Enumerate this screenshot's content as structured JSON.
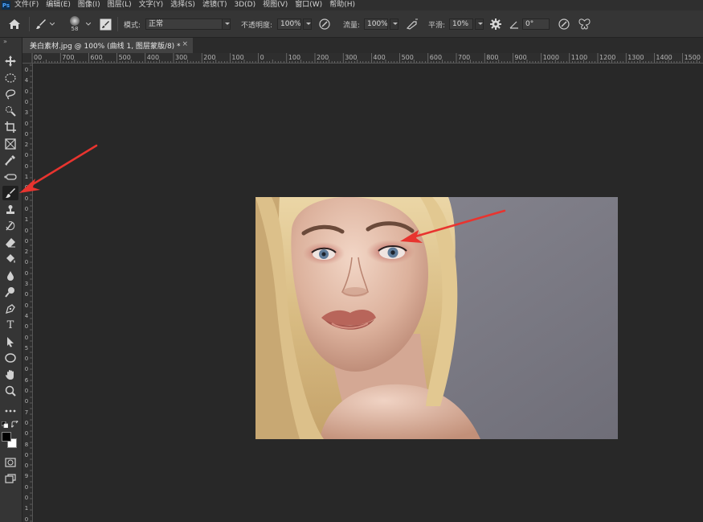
{
  "app": {
    "logo_text": "Ps",
    "accent": "#31a8ff"
  },
  "menu": [
    "文件(F)",
    "编辑(E)",
    "图像(I)",
    "图层(L)",
    "文字(Y)",
    "选择(S)",
    "滤镜(T)",
    "3D(D)",
    "视图(V)",
    "窗口(W)",
    "帮助(H)"
  ],
  "options": {
    "brush_size": "58",
    "mode_label": "模式:",
    "mode_value": "正常",
    "opacity_label": "不透明度:",
    "opacity_value": "100%",
    "flow_label": "流量:",
    "flow_value": "100%",
    "smoothing_label": "平滑:",
    "smoothing_value": "10%",
    "angle_value": "0°"
  },
  "document": {
    "tab_title": "美白素材.jpg @ 100% (曲线 1, 图层蒙版/8) *",
    "close_glyph": "×"
  },
  "ruler_top": [
    "00",
    "700",
    "600",
    "500",
    "400",
    "300",
    "200",
    "100",
    "0",
    "100",
    "200",
    "300",
    "400",
    "500",
    "600",
    "700",
    "800",
    "900",
    "1000",
    "1100",
    "1200",
    "1300",
    "1400",
    "1500"
  ],
  "ruler_left": [
    "0",
    "4",
    "0",
    "0",
    "3",
    "0",
    "0",
    "2",
    "0",
    "0",
    "1",
    "0",
    "0",
    "0",
    "1",
    "0",
    "0",
    "2",
    "0",
    "0",
    "3",
    "0",
    "0",
    "4",
    "0",
    "0",
    "5",
    "0",
    "0",
    "6",
    "0",
    "0",
    "7",
    "0",
    "0",
    "8",
    "0",
    "0",
    "9",
    "0",
    "0",
    "1",
    "0"
  ],
  "toolbar": {
    "collapse_glyph": "»",
    "tools": [
      "move-icon",
      "marquee-icon",
      "lasso-icon",
      "quick-select-icon",
      "crop-icon",
      "frame-icon",
      "eyedropper-icon",
      "healing-icon",
      "brush-icon",
      "stamp-icon",
      "history-brush-icon",
      "eraser-icon",
      "paint-bucket-icon",
      "blur-icon",
      "dodge-icon",
      "pen-icon",
      "type-icon",
      "path-select-icon",
      "ellipse-icon",
      "hand-icon",
      "zoom-icon",
      "more-icon"
    ],
    "active_tool": "brush-icon",
    "type_glyph": "T"
  },
  "colors": {
    "foreground": "#000000",
    "background": "#ffffff",
    "annotation_arrow": "#e8342f"
  }
}
